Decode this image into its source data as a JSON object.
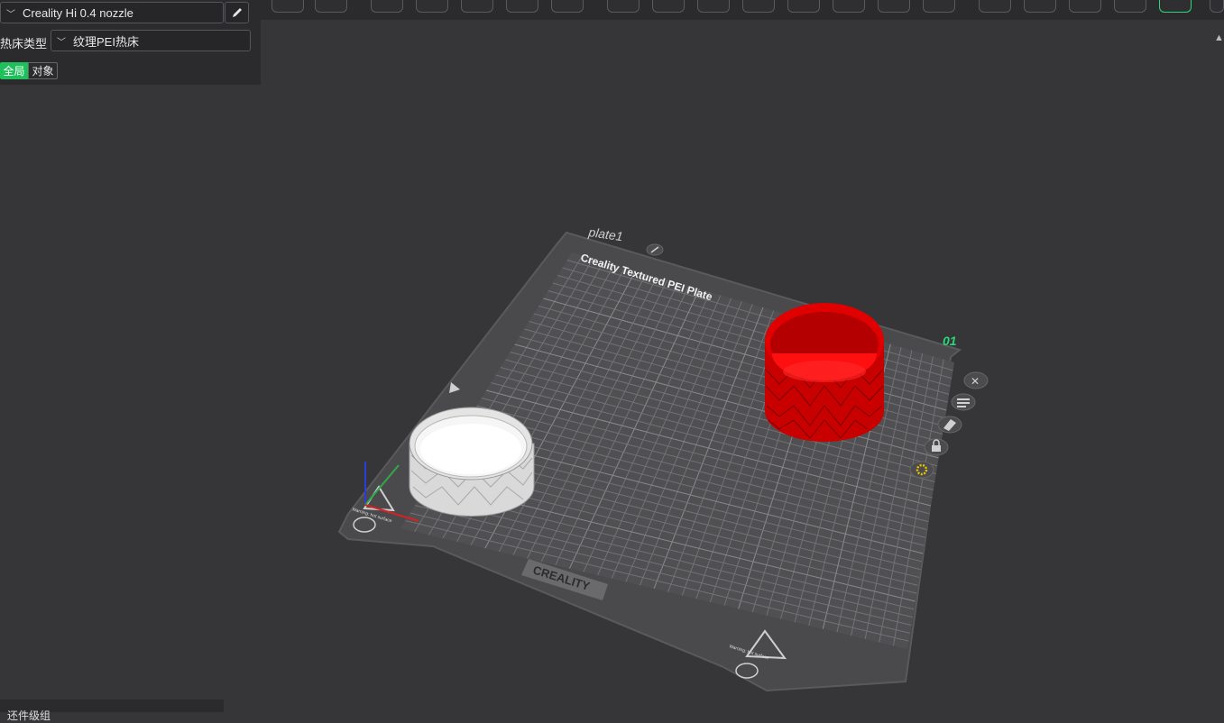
{
  "left_panel": {
    "printer": "Creality Hi 0.4 nozzle",
    "bed_type_label": "热床类型",
    "bed_type_value": "纹理PEI热床",
    "tabs": {
      "global": "全局",
      "object": "对象"
    }
  },
  "plate": {
    "name": "plate1",
    "title": "Creality Textured PEI Plate",
    "brand": "CREALITY",
    "index": "01",
    "warning": "Warning: hot surface"
  },
  "bottom_panel": {
    "label": "还件级组"
  },
  "colors": {
    "accent": "#1ec05b",
    "selected_object": "#e00000",
    "object": "#ececec"
  }
}
